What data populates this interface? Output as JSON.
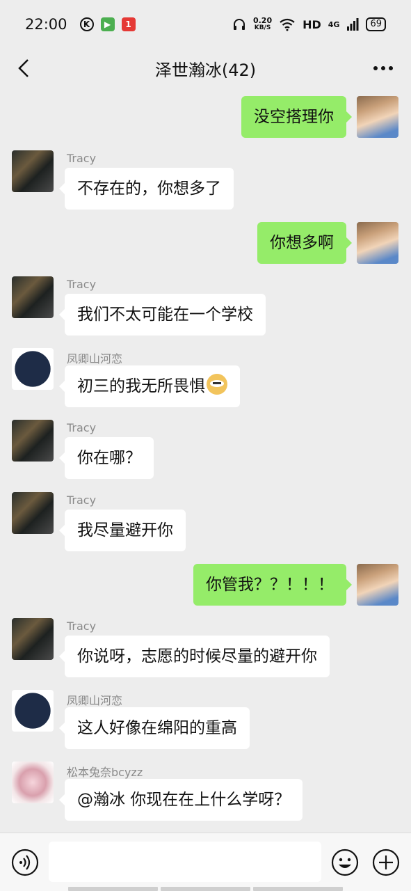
{
  "status_bar": {
    "time": "22:00",
    "speed_value": "0.20",
    "speed_unit": "KB/S",
    "hd": "HD",
    "network": "4G",
    "battery": "69",
    "app_badges": [
      "K",
      "▶",
      "1"
    ]
  },
  "header": {
    "title": "泽世瀚冰(42)"
  },
  "messages": [
    {
      "direction": "out",
      "sender": "",
      "text": "没空搭理你"
    },
    {
      "direction": "in",
      "sender": "Tracy",
      "text": "不存在的，你想多了"
    },
    {
      "direction": "out",
      "sender": "",
      "text": "你想多啊"
    },
    {
      "direction": "in",
      "sender": "Tracy",
      "text": "我们不太可能在一个学校"
    },
    {
      "direction": "in",
      "sender": "凤卿山河恋",
      "text": "初三的我无所畏惧"
    },
    {
      "direction": "in",
      "sender": "Tracy",
      "text": "你在哪？"
    },
    {
      "direction": "in",
      "sender": "Tracy",
      "text": "我尽量避开你"
    },
    {
      "direction": "out",
      "sender": "",
      "text": "你管我？？！！！"
    },
    {
      "direction": "in",
      "sender": "Tracy",
      "text": "你说呀，志愿的时候尽量的避开你"
    },
    {
      "direction": "in",
      "sender": "凤卿山河恋",
      "text": "这人好像在绵阳的重高"
    },
    {
      "direction": "in",
      "sender": "松本兔奈bcyzz",
      "text": "@瀚冰  你现在在上什么学呀？"
    }
  ],
  "input": {
    "value": "",
    "placeholder": ""
  },
  "icons": {
    "back": "back-arrow-icon",
    "more": "more-dots-icon",
    "voice": "voice-icon",
    "emoji": "emoji-icon",
    "plus": "plus-icon"
  },
  "colors": {
    "background": "#ededed",
    "outgoing_bubble": "#95ec69",
    "incoming_bubble": "#ffffff",
    "sender_name": "#8a8a8a"
  }
}
